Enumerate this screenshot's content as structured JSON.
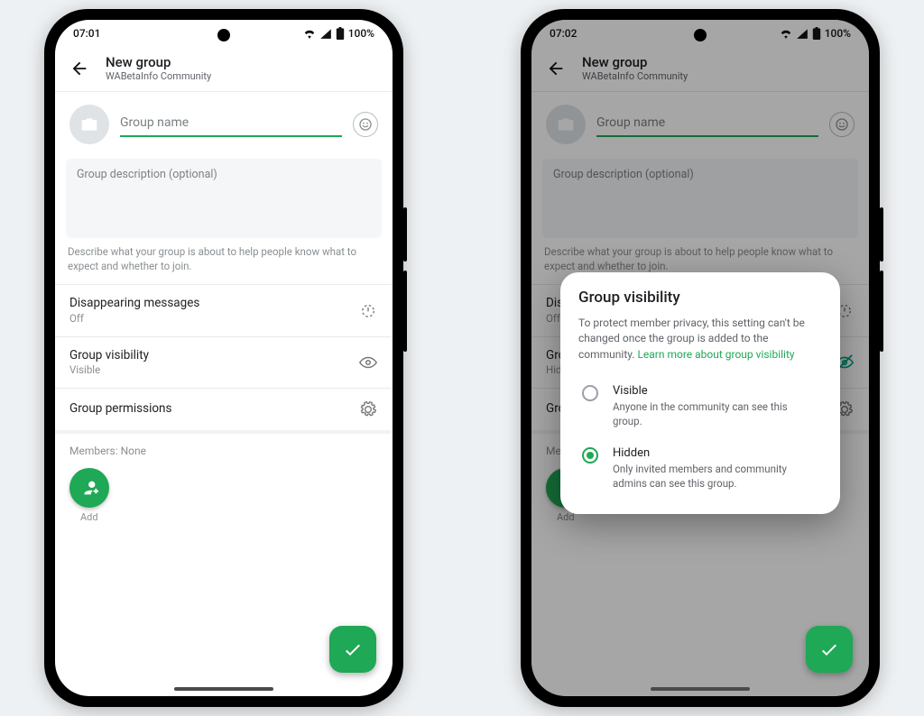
{
  "status": {
    "time_a": "07:01",
    "time_b": "07:02",
    "battery": "100%"
  },
  "header": {
    "title": "New group",
    "subtitle": "WABetaInfo Community"
  },
  "name_input": {
    "placeholder": "Group name"
  },
  "description": {
    "placeholder": "Group description (optional)",
    "hint": "Describe what your group is about to help people know what to expect and whether to join."
  },
  "settings": {
    "disappearing": {
      "label": "Disappearing messages",
      "value": "Off"
    },
    "visibility": {
      "label": "Group visibility",
      "value_a": "Visible",
      "value_b": "Hidden"
    },
    "permissions": {
      "label": "Group permissions"
    }
  },
  "members": {
    "header": "Members: None",
    "add_label": "Add"
  },
  "modal": {
    "title": "Group visibility",
    "body": "To protect member privacy, this setting can't be changed once the group is added to the community. ",
    "link": "Learn more about group visibility",
    "options": [
      {
        "title": "Visible",
        "desc": "Anyone in the community can see this group."
      },
      {
        "title": "Hidden",
        "desc": "Only invited members and community admins can see this group."
      }
    ]
  }
}
